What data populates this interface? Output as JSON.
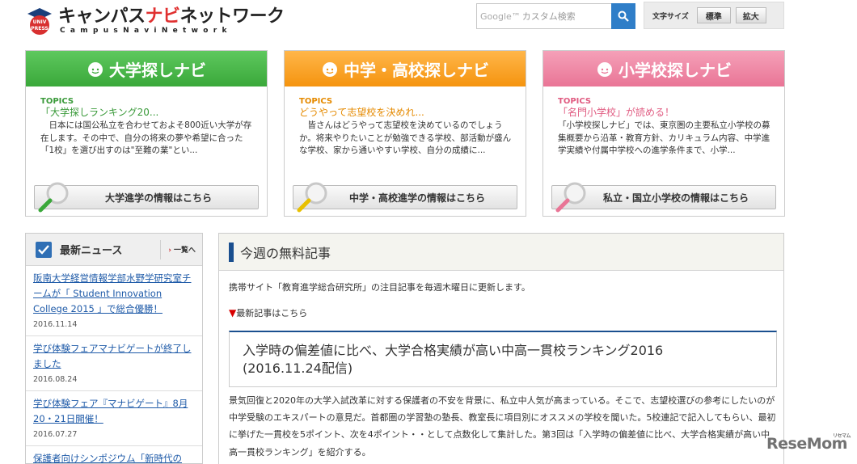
{
  "header": {
    "logo_badge": "UNIV PRESS",
    "logo_jp_a": "キャンパス",
    "logo_jp_b": "ナビ",
    "logo_jp_c": "ネットワーク",
    "logo_en": "CampusNaviNetwork",
    "search": {
      "google_mark": "Google™",
      "placeholder": "カスタム検索"
    },
    "font_size": {
      "label": "文字サイズ",
      "standard": "標準",
      "large": "拡大"
    }
  },
  "navi": [
    {
      "title": "大学探しナビ",
      "topics_label": "TOPICS",
      "topic_title": "「大学探しランキング20...",
      "topic_text": "　日本には国公私立を合わせておよそ800近い大学が存在します。その中で、自分の将来の夢や希望に合った「1校」を選び出すのは\"至難の業\"とい...",
      "button": "大学進学の情報はこちら",
      "color": "#3aa83a"
    },
    {
      "title": "中学・高校探しナビ",
      "topics_label": "TOPICS",
      "topic_title": "どうやって志望校を決めれ...",
      "topic_text": "　皆さんはどうやって志望校を決めているのでしょうか。将来やりたいことが勉強できる学校、部活動が盛んな学校、家から通いやすい学校、自分の成績に...",
      "button": "中学・高校進学の情報はこちら",
      "color": "#f5940f"
    },
    {
      "title": "小学校探しナビ",
      "topics_label": "TOPICS",
      "topic_title": "「名門小学校」が読める！",
      "topic_text": "「小学校探しナビ」では、東京圏の主要私立小学校の募集概要から沿革・教育方針、カリキュラム内容、中学進学実績や付属中学校への進学条件まで、小学...",
      "button": "私立・国立小学校の情報はこちら",
      "color": "#e97596"
    }
  ],
  "news": {
    "title": "最新ニュース",
    "more": "一覧へ",
    "items": [
      {
        "text": "阪南大学経営情報学部水野学研究室チームが「 Student Innovation College 2015 」で総合優勝！",
        "date": "2016.11.14"
      },
      {
        "text": "学び体験フェアマナビゲートが終了しました",
        "date": "2016.08.24"
      },
      {
        "text": "学び体験フェア『マナビゲート』8月20・21日開催！",
        "date": "2016.07.27"
      },
      {
        "text": "保護者向けシンポジウム「新時代の",
        "date": ""
      }
    ]
  },
  "main": {
    "title": "今週の無料記事",
    "lead": "携帯サイト「教育進学総合研究所」の注目記事を毎週木曜日に更新します。",
    "latest_marker": "▼",
    "latest": "最新記事はこちら",
    "article_title_1": "入学時の偏差値に比べ、大学合格実績が高い中高一貫校ランキング2016",
    "article_title_2": "(2016.11.24配信)",
    "article_text": "景気回復と2020年の大学入試改革に対する保護者の不安を背景に、私立中人気が高まっている。そこで、志望校選びの参考にしたいのが中学受験のエキスパートの意見だ。首都圏の学習塾の塾長、教室長に項目別にオススメの学校を聞いた。5校連記で記入してもらい、最初に挙げた一貫校を5ポイント、次を4ポイント・・として点数化して集計した。第3回は「入学時の偏差値に比べ、大学合格実績が高い中高一貫校ランキング」を紹介する。"
  },
  "watermark": {
    "text": "ReseMom",
    "sub": "リセマム"
  }
}
